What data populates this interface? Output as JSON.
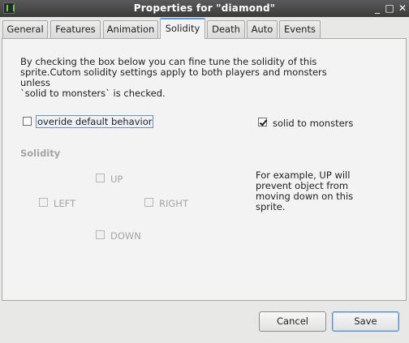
{
  "window": {
    "title": "Properties for \"diamond\"",
    "buttons": [
      "_",
      "□",
      "✕"
    ]
  },
  "tabs": [
    {
      "label": "General",
      "active": false
    },
    {
      "label": "Features",
      "active": false
    },
    {
      "label": "Animation",
      "active": false
    },
    {
      "label": "Solidity",
      "active": true
    },
    {
      "label": "Death",
      "active": false
    },
    {
      "label": "Auto",
      "active": false
    },
    {
      "label": "Events",
      "active": false
    }
  ],
  "solidity": {
    "intro_line1": "By checking the box below you can fine tune the solidity of this",
    "intro_line2": "sprite.Cutom solidity settings apply to both players and monsters unless",
    "intro_line3": "`solid to monsters` is checked.",
    "override_label": "overide default behavior",
    "override_checked": false,
    "solid_to_monsters_label": "solid to monsters",
    "solid_to_monsters_checked": true,
    "section_title": "Solidity",
    "up_label": "UP",
    "left_label": "LEFT",
    "right_label": "RIGHT",
    "down_label": "DOWN",
    "example_text": "For example, UP will prevent object from moving down on this sprite."
  },
  "footer": {
    "cancel_label": "Cancel",
    "save_label": "Save"
  }
}
